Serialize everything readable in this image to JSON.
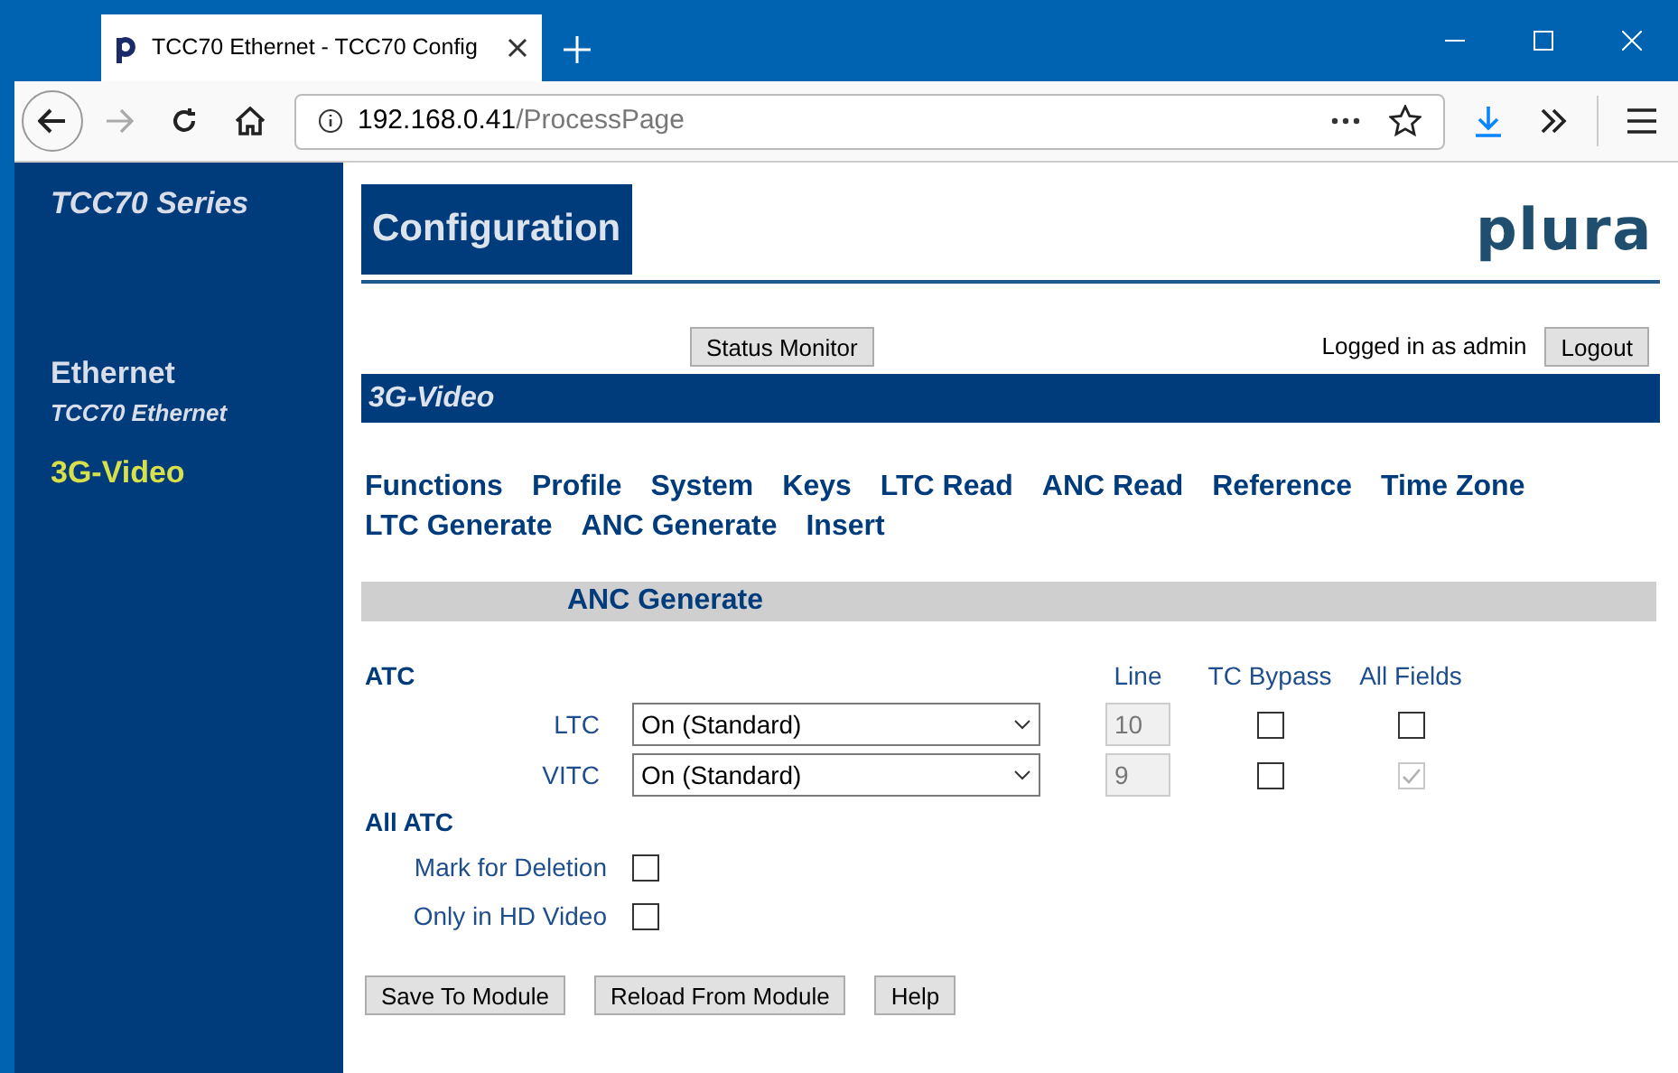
{
  "browser": {
    "tab_title": "TCC70 Ethernet - TCC70 Config",
    "url_host": "192.168.0.41",
    "url_path": "/ProcessPage"
  },
  "sidebar": {
    "title": "TCC70 Series",
    "items": [
      {
        "label": "Ethernet",
        "subtitle": "TCC70 Ethernet",
        "selected": false
      },
      {
        "label": "3G-Video",
        "selected": true
      }
    ]
  },
  "header": {
    "title": "Configuration",
    "logo": "plura"
  },
  "status_button": "Status Monitor",
  "login_text": "Logged in as admin",
  "logout_button": "Logout",
  "section_bar": "3G-Video",
  "nav_links": [
    "Functions",
    "Profile",
    "System",
    "Keys",
    "LTC Read",
    "ANC Read",
    "Reference",
    "Time Zone",
    "LTC Generate",
    "ANC Generate",
    "Insert"
  ],
  "panel_title": "ANC Generate",
  "atc": {
    "heading": "ATC",
    "columns": [
      "Line",
      "TC Bypass",
      "All Fields"
    ],
    "rows": [
      {
        "label": "LTC",
        "mode": "On (Standard)",
        "line": "10",
        "tc_bypass": {
          "checked": false,
          "disabled": false
        },
        "all_fields": {
          "checked": false,
          "disabled": false
        }
      },
      {
        "label": "VITC",
        "mode": "On (Standard)",
        "line": "9",
        "tc_bypass": {
          "checked": false,
          "disabled": false
        },
        "all_fields": {
          "checked": true,
          "disabled": true
        }
      }
    ]
  },
  "all_atc": {
    "heading": "All ATC",
    "options": [
      {
        "label": "Mark for Deletion",
        "checked": false
      },
      {
        "label": "Only in HD Video",
        "checked": false
      }
    ]
  },
  "buttons": [
    "Save To Module",
    "Reload From Module",
    "Help"
  ]
}
